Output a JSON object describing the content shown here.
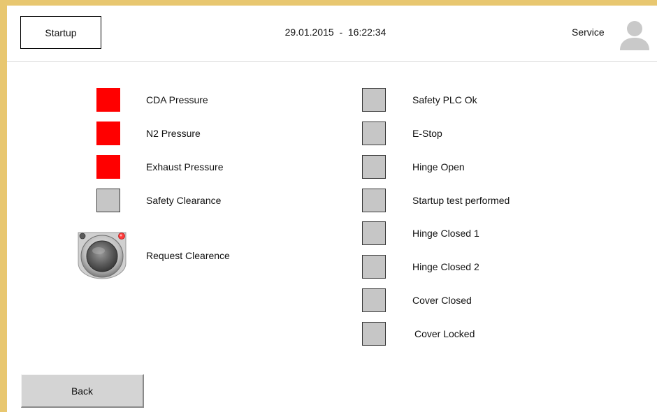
{
  "header": {
    "title": "Startup",
    "datetime": "29.01.2015  -  16:22:34",
    "user": "Service",
    "user_icon": "user-avatar-icon"
  },
  "left_signals": [
    {
      "label": "CDA Pressure",
      "state": "active",
      "color": "#ff0000"
    },
    {
      "label": "N2 Pressure",
      "state": "active",
      "color": "#ff0000"
    },
    {
      "label": "Exhaust Pressure",
      "state": "active",
      "color": "#ff0000"
    },
    {
      "label": "Safety Clearance",
      "state": "inactive",
      "color": "#c6c6c6"
    }
  ],
  "request_button": {
    "label": "Request Clearence",
    "icon": "round-push-button-icon",
    "indicator_color": "#ff3b3b"
  },
  "right_signals": [
    {
      "label": "Safety PLC Ok",
      "state": "inactive"
    },
    {
      "label": "E-Stop",
      "state": "inactive"
    },
    {
      "label": "Hinge Open",
      "state": "inactive"
    },
    {
      "label": "Startup test performed",
      "state": "inactive"
    },
    {
      "label": "Hinge Closed 1",
      "state": "inactive"
    },
    {
      "label": "Hinge Closed 2",
      "state": "inactive"
    },
    {
      "label": "Cover Closed",
      "state": "inactive"
    },
    {
      "label": "Cover Locked",
      "state": "inactive"
    }
  ],
  "footer": {
    "back_label": "Back"
  },
  "colors": {
    "frame": "#e8c770",
    "alarm": "#ff0000",
    "idle": "#c6c6c6"
  }
}
